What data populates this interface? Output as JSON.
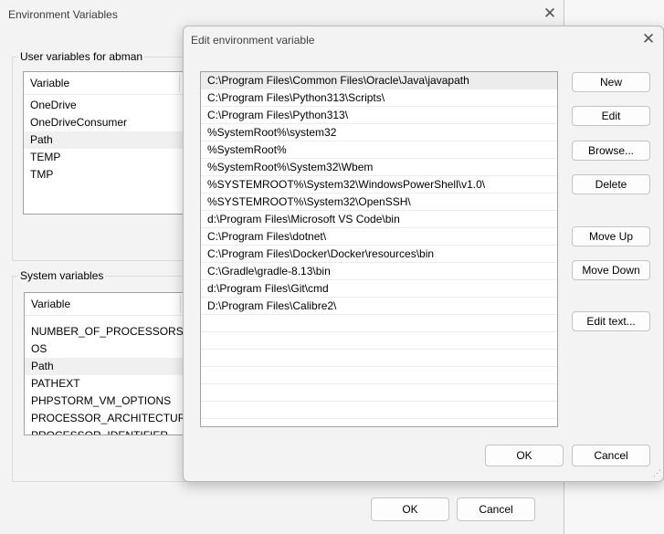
{
  "env_window": {
    "title": "Environment Variables",
    "close_glyph": "✕",
    "user_group_label": "User variables for abman",
    "user_list": {
      "header": "Variable",
      "rows": [
        "OneDrive",
        "OneDriveConsumer",
        "Path",
        "TEMP",
        "TMP"
      ],
      "selected_index": 2
    },
    "system_group_label": "System variables",
    "system_list": {
      "header": "Variable",
      "rows": [
        "NUMBER_OF_PROCESSORS",
        "OS",
        "Path",
        "PATHEXT",
        "PHPSTORM_VM_OPTIONS",
        "PROCESSOR_ARCHITECTURE",
        "PROCESSOR_IDENTIFIER"
      ],
      "selected_index": 2
    },
    "ok_label": "OK",
    "cancel_label": "Cancel"
  },
  "edit_dialog": {
    "title": "Edit environment variable",
    "close_glyph": "✕",
    "paths": [
      "C:\\Program Files\\Common Files\\Oracle\\Java\\javapath",
      "C:\\Program Files\\Python313\\Scripts\\",
      "C:\\Program Files\\Python313\\",
      "%SystemRoot%\\system32",
      "%SystemRoot%",
      "%SystemRoot%\\System32\\Wbem",
      "%SYSTEMROOT%\\System32\\WindowsPowerShell\\v1.0\\",
      "%SYSTEMROOT%\\System32\\OpenSSH\\",
      "d:\\Program Files\\Microsoft VS Code\\bin",
      "C:\\Program Files\\dotnet\\",
      "C:\\Program Files\\Docker\\Docker\\resources\\bin",
      "C:\\Gradle\\gradle-8.13\\bin",
      "d:\\Program Files\\Git\\cmd",
      "D:\\Program Files\\Calibre2\\",
      "",
      "",
      "",
      "",
      "",
      "",
      ""
    ],
    "selected_index": 0,
    "buttons": {
      "new": "New",
      "edit": "Edit",
      "browse": "Browse...",
      "delete": "Delete",
      "move_up": "Move Up",
      "move_down": "Move Down",
      "edit_text": "Edit text..."
    },
    "ok_label": "OK",
    "cancel_label": "Cancel"
  },
  "colors": {
    "dialog_bg": "#f3f3f3",
    "selection": "#ececec",
    "border": "#a0a0a0"
  }
}
